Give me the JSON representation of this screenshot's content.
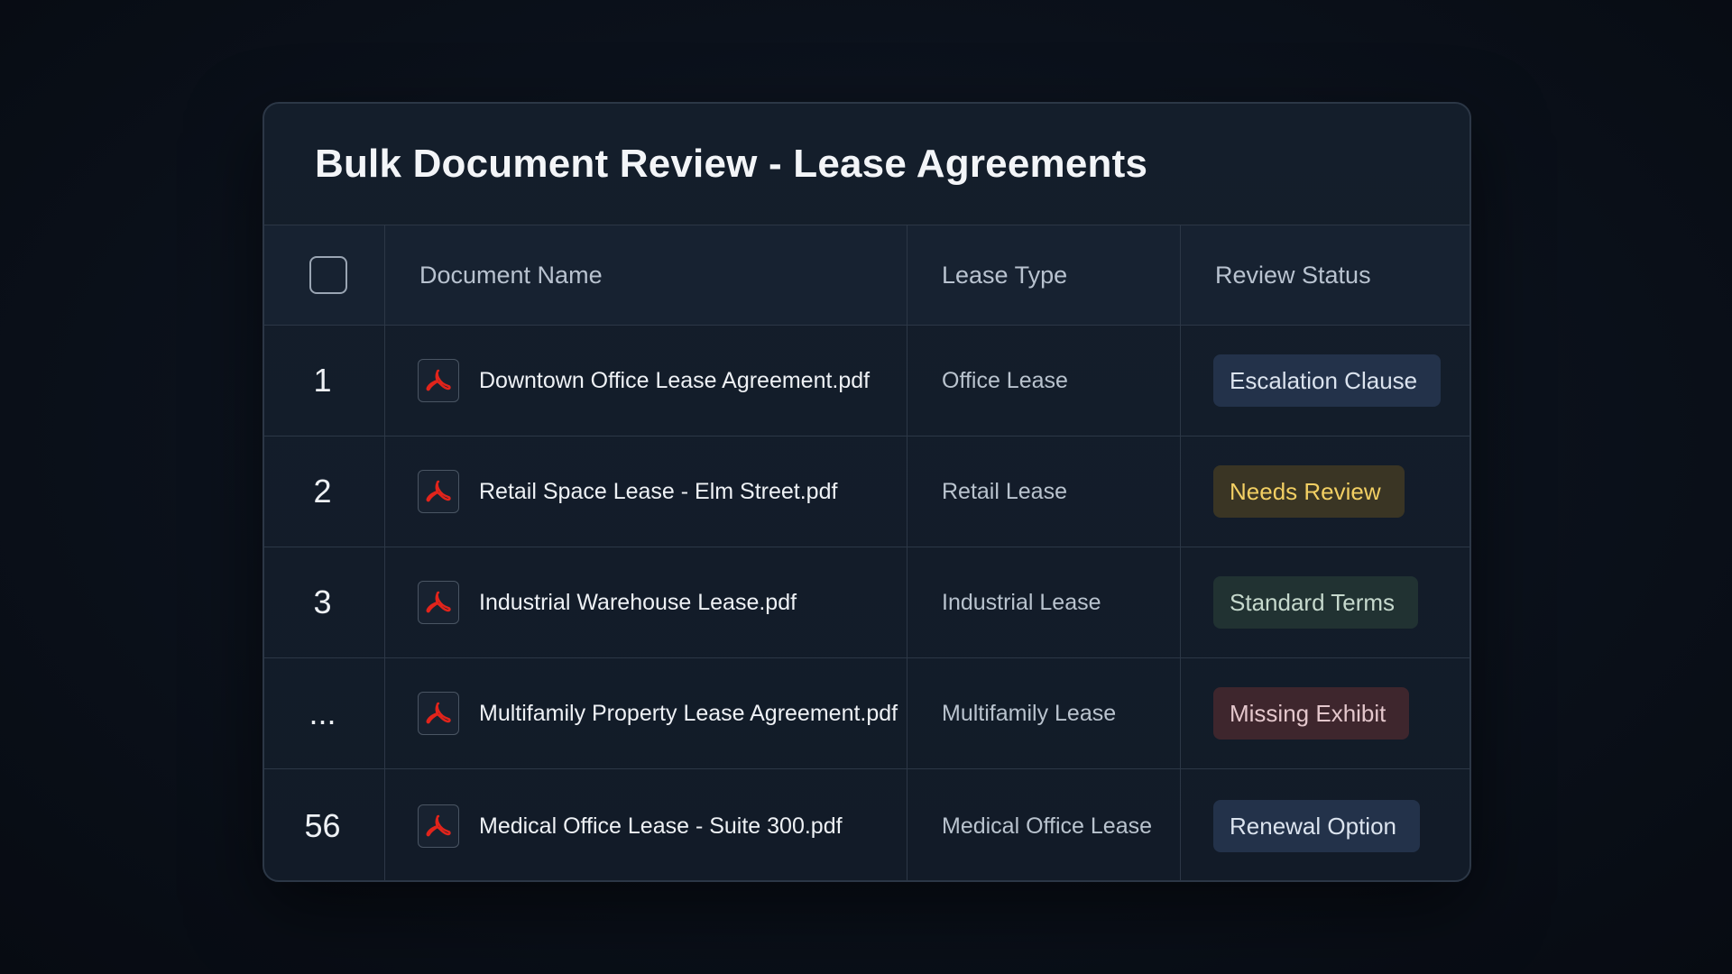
{
  "title": "Bulk Document Review - Lease Agreements",
  "columns": {
    "document_name": "Document Name",
    "lease_type": "Lease Type",
    "review_status": "Review Status"
  },
  "rows": [
    {
      "num": "1",
      "document": "Downtown Office Lease Agreement.pdf",
      "lease_type": "Office Lease",
      "status": "Escalation Clause",
      "status_color": "#23324a"
    },
    {
      "num": "2",
      "document": "Retail Space Lease - Elm Street.pdf",
      "lease_type": "Retail Lease",
      "status": "Needs Review",
      "status_color": "#3a3524"
    },
    {
      "num": "3",
      "document": "Industrial Warehouse Lease.pdf",
      "lease_type": "Industrial Lease",
      "status": "Standard Terms",
      "status_color": "#213232"
    },
    {
      "num": "...",
      "document": "Multifamily Property Lease Agreement.pdf",
      "lease_type": "Multifamily Lease",
      "status": "Missing Exhibit",
      "status_color": "#3e262d"
    },
    {
      "num": "56",
      "document": "Medical Office Lease - Suite 300.pdf",
      "lease_type": "Medical Office Lease",
      "status": "Renewal Option",
      "status_color": "#23324a"
    }
  ],
  "colors": {
    "background": "#0a0f18",
    "card": "#141e2b",
    "border": "#2c3746",
    "pdf_red": "#e2241b",
    "needs_review_text": "#f2cf63"
  },
  "icons": {
    "document": "pdf-icon",
    "select_all": "checkbox"
  }
}
